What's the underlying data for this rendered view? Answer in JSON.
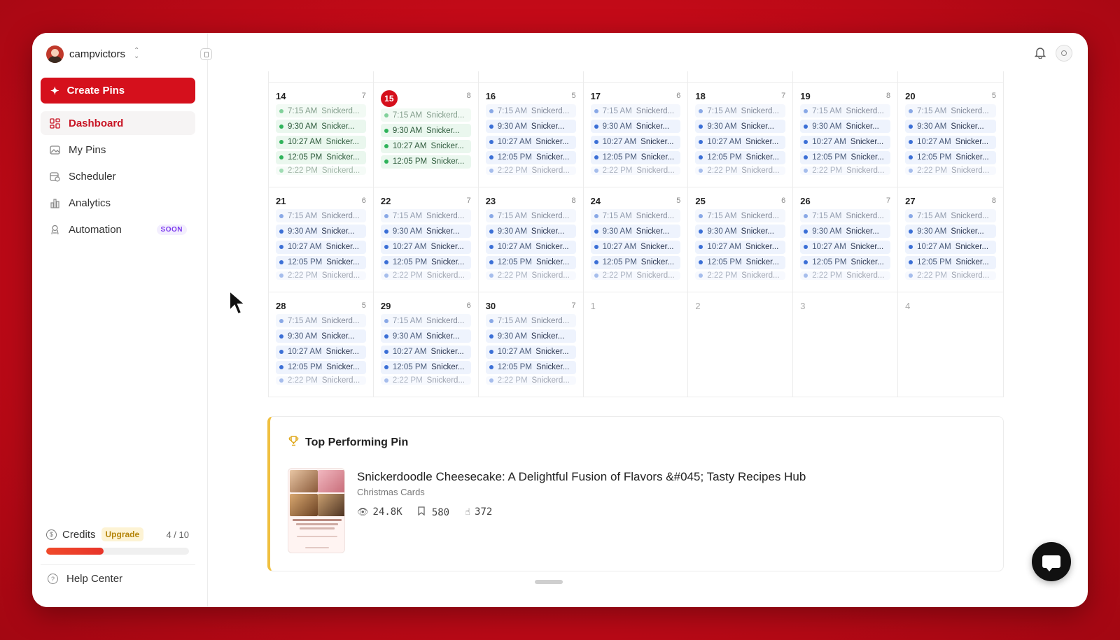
{
  "workspace": {
    "name": "campvictors"
  },
  "sidebar": {
    "create_label": "Create Pins",
    "items": [
      {
        "label": "Dashboard",
        "icon": "grid-icon",
        "active": true
      },
      {
        "label": "My Pins",
        "icon": "image-icon"
      },
      {
        "label": "Scheduler",
        "icon": "calendar-clock-icon"
      },
      {
        "label": "Analytics",
        "icon": "bar-chart-icon"
      },
      {
        "label": "Automation",
        "icon": "robot-icon",
        "badge": "SOON"
      }
    ],
    "credits": {
      "label": "Credits",
      "upgrade": "Upgrade",
      "used": "4 / 10",
      "fraction": 0.4
    },
    "help": "Help Center"
  },
  "calendar": {
    "weeks": [
      [
        {
          "day": "14",
          "count": "7"
        },
        {
          "day": "15",
          "count": "8",
          "today": true
        },
        {
          "day": "16",
          "count": "5"
        },
        {
          "day": "17",
          "count": "6"
        },
        {
          "day": "18",
          "count": "7"
        },
        {
          "day": "19",
          "count": "8"
        },
        {
          "day": "20",
          "count": "5"
        }
      ],
      [
        {
          "day": "21",
          "count": "6"
        },
        {
          "day": "22",
          "count": "7"
        },
        {
          "day": "23",
          "count": "8"
        },
        {
          "day": "24",
          "count": "5"
        },
        {
          "day": "25",
          "count": "6"
        },
        {
          "day": "26",
          "count": "7"
        },
        {
          "day": "27",
          "count": "8"
        }
      ],
      [
        {
          "day": "28",
          "count": "5"
        },
        {
          "day": "29",
          "count": "6"
        },
        {
          "day": "30",
          "count": "7"
        },
        {
          "day": "1",
          "count": "",
          "muted": true
        },
        {
          "day": "2",
          "count": "",
          "muted": true
        },
        {
          "day": "3",
          "count": "",
          "muted": true
        },
        {
          "day": "4",
          "count": "",
          "muted": true
        }
      ]
    ],
    "events": [
      {
        "time": "7:15 AM",
        "name": "Snickerd..."
      },
      {
        "time": "9:30 AM",
        "name": "Snicker..."
      },
      {
        "time": "10:27 AM",
        "name": "Snicker..."
      },
      {
        "time": "12:05 PM",
        "name": "Snicker..."
      },
      {
        "time": "2:22 PM",
        "name": "Snickerd..."
      }
    ],
    "colors": {
      "scheduled": "#3b6fd6",
      "published": "#2fb35a"
    }
  },
  "top_pin": {
    "heading": "Top Performing Pin",
    "title": "Snickerdoodle Cheesecake: A Delightful Fusion of Flavors &#045; Tasty Recipes Hub",
    "board": "Christmas Cards",
    "views": "24.8K",
    "saves": "580",
    "clicks": "372"
  },
  "accent": "#d5101c"
}
